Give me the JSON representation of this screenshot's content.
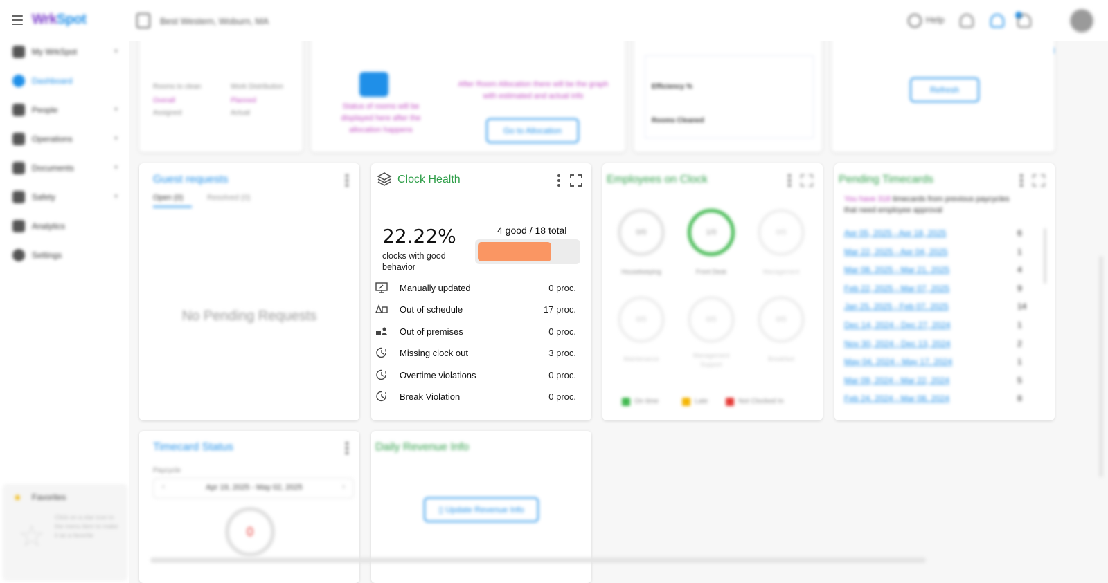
{
  "app": {
    "logo_main": "Wrk",
    "logo_accent": "Spot",
    "location": "Best Western, Woburn, MA",
    "help_label": "Help"
  },
  "sidebar": {
    "items": [
      {
        "label": "My WrkSpot",
        "icon": "home-icon",
        "has_chevron": true
      },
      {
        "label": "Dashboard",
        "icon": "dashboard-icon",
        "active": true
      },
      {
        "label": "People",
        "icon": "people-icon",
        "has_chevron": true
      },
      {
        "label": "Operations",
        "icon": "operations-icon",
        "has_chevron": true
      },
      {
        "label": "Documents",
        "icon": "documents-icon",
        "has_chevron": true
      },
      {
        "label": "Safety",
        "icon": "safety-icon",
        "has_chevron": true
      },
      {
        "label": "Analytics",
        "icon": "analytics-icon"
      },
      {
        "label": "Settings",
        "icon": "settings-icon"
      }
    ],
    "favorites_label": "Favorites",
    "favorites_hint": "Click on a star icon in the menu item to make it as a favorite"
  },
  "top_cards": {
    "rooms_to_clean": "Rooms to clean",
    "overall": "Overall",
    "assigned": "Assigned",
    "work_distribution": "Work Distribution",
    "planned": "Planned",
    "actual": "Actual",
    "status_rooms_text": "Status of rooms will be displayed here after the allocation happens",
    "after_allocation_text": "After Room Allocation there will be the graph with estimated and actual info",
    "go_to_allocation": "Go to Allocation",
    "efficiency": "Efficiency %",
    "rooms_cleaned": "Rooms Cleaned",
    "refresh": "Refresh"
  },
  "guest_requests": {
    "title": "Guest requests",
    "tab_open": "Open (0)",
    "tab_resolved": "Resolved (0)",
    "empty": "No Pending Requests"
  },
  "clock_health": {
    "title": "Clock Health",
    "percent": "22.22%",
    "subtitle": "clocks with good behavior",
    "good_total": "4 good / 18 total",
    "good_fraction": 0.2222,
    "colors": {
      "bar": "#fa9663",
      "title": "#2e9e48"
    },
    "metrics": [
      {
        "label": "Manually updated",
        "value": "0 proc.",
        "icon": "monitor-edit-icon"
      },
      {
        "label": "Out of schedule",
        "value": "17 proc.",
        "icon": "schedule-icon"
      },
      {
        "label": "Out of premises",
        "value": "0 proc.",
        "icon": "premises-icon"
      },
      {
        "label": "Missing clock out",
        "value": "3 proc.",
        "icon": "clock-alert-icon"
      },
      {
        "label": "Overtime violations",
        "value": "0 proc.",
        "icon": "clock-alert-icon"
      },
      {
        "label": "Break Violation",
        "value": "0 proc.",
        "icon": "clock-alert-icon"
      }
    ]
  },
  "employees_on_clock": {
    "title": "Employees on Clock",
    "departments": [
      {
        "name": "Housekeeping",
        "value": "0/0"
      },
      {
        "name": "Front Desk",
        "value": "1/0"
      },
      {
        "name": "Management",
        "value": "0/0"
      },
      {
        "name": "Maintenance",
        "value": "0/0"
      },
      {
        "name": "Management Support",
        "value": "0/0"
      },
      {
        "name": "Breakfast",
        "value": "0/0"
      }
    ],
    "legend": [
      {
        "label": "On time",
        "color": "#3fb84e"
      },
      {
        "label": "Late",
        "color": "#f4b400"
      },
      {
        "label": "Not Clocked In",
        "color": "#e53935"
      }
    ]
  },
  "pending_timecards": {
    "title": "Pending Timecards",
    "intro_prefix": "You have 318",
    "intro_suffix": "timecards from previous paycycles that need employee approval",
    "rows": [
      {
        "period": "Apr 05, 2025 - Apr 18, 2025",
        "count": "6"
      },
      {
        "period": "Mar 22, 2025 - Apr 04, 2025",
        "count": "1"
      },
      {
        "period": "Mar 08, 2025 - Mar 21, 2025",
        "count": "4"
      },
      {
        "period": "Feb 22, 2025 - Mar 07, 2025",
        "count": "9"
      },
      {
        "period": "Jan 25, 2025 - Feb 07, 2025",
        "count": "14"
      },
      {
        "period": "Dec 14, 2024 - Dec 27, 2024",
        "count": "1"
      },
      {
        "period": "Nov 30, 2024 - Dec 13, 2024",
        "count": "2"
      },
      {
        "period": "May 04, 2024 - May 17, 2024",
        "count": "1"
      },
      {
        "period": "Mar 09, 2024 - Mar 22, 2024",
        "count": "5"
      },
      {
        "period": "Feb 24, 2024 - Mar 08, 2024",
        "count": "8"
      }
    ]
  },
  "timecard_status": {
    "title": "Timecard Status",
    "paycycle_label": "Paycycle",
    "paycycle_value": "Apr 19, 2025 - May 02, 2025",
    "donut_value": "0"
  },
  "daily_revenue": {
    "title": "Daily Revenue Info",
    "button": "Update Revenue Info"
  }
}
